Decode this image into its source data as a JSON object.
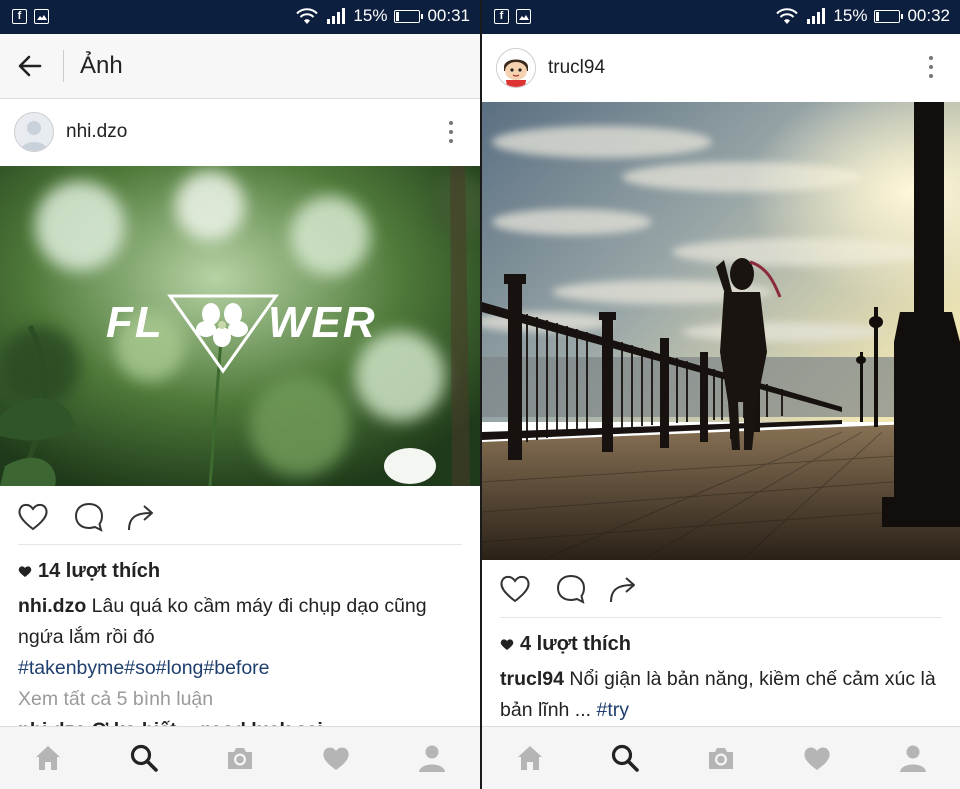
{
  "status_left": {
    "time": "00:31",
    "battery": "15%"
  },
  "status_right": {
    "time": "00:32",
    "battery": "15%"
  },
  "left": {
    "appbar_title": "Ảnh",
    "username": "nhi.dzo",
    "photo_overlay_left": "FL",
    "photo_overlay_right": "WER",
    "likes": "14 lượt thích",
    "caption_user": "nhi.dzo",
    "caption_text": " Lâu quá ko cầm máy đi chụp dạo cũng ngứa lắm rồi đó",
    "hashtags": "#takenbyme#so#long#before",
    "view_comments": "Xem tất cả 5 bình luận",
    "partial_comment": "nhi.dzo Ơ ko biết... good luck sai"
  },
  "right": {
    "username": "trucl94",
    "likes": "4 lượt thích",
    "caption_user": "trucl94",
    "caption_text": " Nổi giận là bản năng, kiềm chế cảm xúc là bản lĩnh ... ",
    "hashtag": "#try"
  },
  "icons": {
    "status": [
      "facebook-icon",
      "gallery-icon",
      "wifi-icon",
      "signal-icon",
      "battery-icon"
    ],
    "actions": [
      "heart-icon",
      "comment-icon",
      "share-icon"
    ],
    "nav": [
      "home-icon",
      "search-icon",
      "camera-icon",
      "heart-icon",
      "profile-icon"
    ]
  },
  "colors": {
    "statusbar": "#0c1f3e",
    "hashtag": "#1e3f6e",
    "muted": "#9a9a9a",
    "nav_active": "#222222",
    "nav_inactive": "#b5b5b5"
  }
}
